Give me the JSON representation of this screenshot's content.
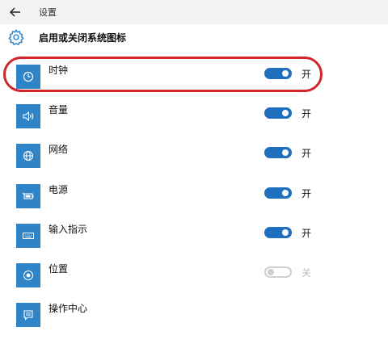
{
  "titlebar": {
    "title": "设置"
  },
  "header": {
    "title": "启用或关闭系统图标"
  },
  "items": [
    {
      "label": "时钟",
      "icon": "clock-icon",
      "state": "开",
      "on": true
    },
    {
      "label": "音量",
      "icon": "volume-icon",
      "state": "开",
      "on": true
    },
    {
      "label": "网络",
      "icon": "globe-icon",
      "state": "开",
      "on": true
    },
    {
      "label": "电源",
      "icon": "battery-icon",
      "state": "开",
      "on": true
    },
    {
      "label": "输入指示",
      "icon": "keyboard-icon",
      "state": "开",
      "on": true
    },
    {
      "label": "位置",
      "icon": "location-icon",
      "state": "关",
      "on": false
    },
    {
      "label": "操作中心",
      "icon": "message-icon"
    }
  ],
  "colors": {
    "accent": "#2f84c8",
    "toggle_on": "#1f6fbf",
    "highlight": "#d1252a"
  }
}
